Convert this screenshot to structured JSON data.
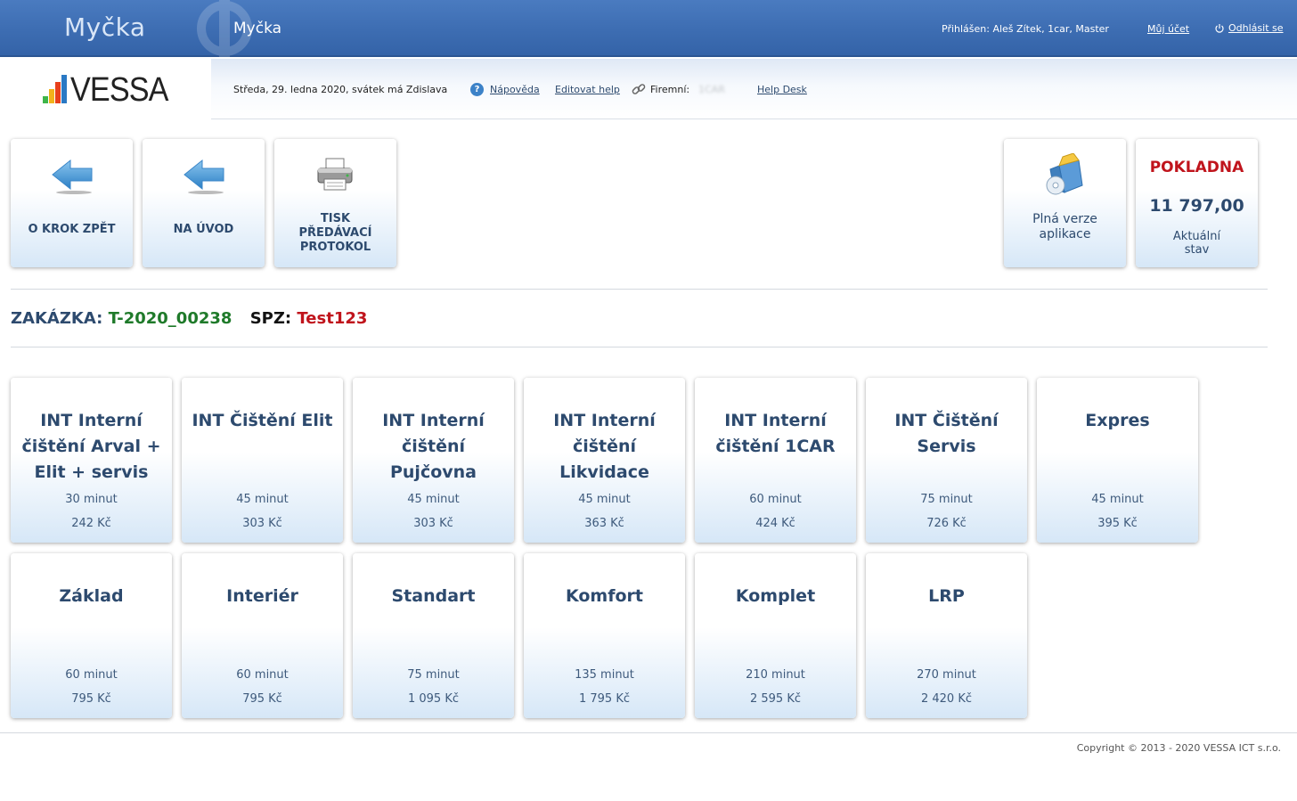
{
  "header": {
    "app_title": "Myčka",
    "module_title": "Myčka",
    "user_info": "Přihlášen: Aleš Zítek, 1car, Master",
    "account_link": "Můj účet",
    "logout_link": "Odhlásit se"
  },
  "subbar": {
    "logo_text": "VESSA",
    "date": "Středa, 29. ledna 2020, svátek má Zdislava",
    "help_link": "Nápověda",
    "edit_help_link": "Editovat help",
    "firm_label": "Firemní:",
    "firm_value": "1CAR",
    "helpdesk_link": "Help Desk"
  },
  "actions": {
    "back_label": "O KROK ZPĚT",
    "home_label": "NA ÚVOD",
    "print_label_1": "TISK",
    "print_label_2": "PŘEDÁVACÍ",
    "print_label_3": "PROTOKOL",
    "full_version_1": "Plná verze",
    "full_version_2": "aplikace",
    "cash_title": "POKLADNA",
    "cash_amount": "11 797,00",
    "cash_sub_1": "Aktuální",
    "cash_sub_2": "stav"
  },
  "order": {
    "order_key": "ZAKÁZKA:",
    "order_value": "T-2020_00238",
    "plate_key": "SPZ:",
    "plate_value": "Test123"
  },
  "programs": [
    {
      "name": "INT Interní čištění Arval + Elit + servis",
      "duration": "30 minut",
      "price": "242 Kč"
    },
    {
      "name": "INT Čištění Elit",
      "duration": "45 minut",
      "price": "303 Kč"
    },
    {
      "name": "INT Interní čištění Pujčovna",
      "duration": "45 minut",
      "price": "303 Kč"
    },
    {
      "name": "INT Interní čištění Likvidace",
      "duration": "45 minut",
      "price": "363 Kč"
    },
    {
      "name": "INT Interní čištění 1CAR",
      "duration": "60 minut",
      "price": "424 Kč"
    },
    {
      "name": "INT Čištění Servis",
      "duration": "75 minut",
      "price": "726 Kč"
    },
    {
      "name": "Expres",
      "duration": "45 minut",
      "price": "395 Kč"
    },
    {
      "name": "Základ",
      "duration": "60 minut",
      "price": "795 Kč"
    },
    {
      "name": "Interiér",
      "duration": "60 minut",
      "price": "795 Kč"
    },
    {
      "name": "Standart",
      "duration": "75 minut",
      "price": "1 095 Kč"
    },
    {
      "name": "Komfort",
      "duration": "135 minut",
      "price": "1 795 Kč"
    },
    {
      "name": "Komplet",
      "duration": "210 minut",
      "price": "2 595 Kč"
    },
    {
      "name": "LRP",
      "duration": "270 minut",
      "price": "2 420 Kč"
    }
  ],
  "footer": {
    "copyright": "Copyright © 2013 - 2020 VESSA ICT s.r.o."
  },
  "colors": {
    "header_blue": "#3d6db2",
    "text_blue": "#2d4a6e",
    "accent_red": "#c0141c",
    "accent_green": "#1f7a2a"
  }
}
